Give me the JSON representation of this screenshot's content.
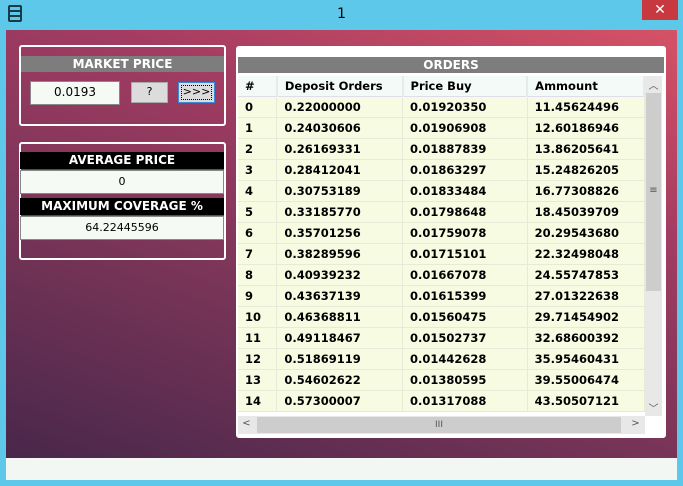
{
  "window": {
    "title": "1",
    "close_label": "✕"
  },
  "market": {
    "title": "MARKET PRICE",
    "value": "0.0193",
    "help_label": "?",
    "go_label": ">>>"
  },
  "stats": {
    "avg_title": "AVERAGE PRICE",
    "avg_value": "0",
    "cov_title": "MAXIMUM COVERAGE %",
    "cov_value": "64.22445596"
  },
  "orders": {
    "title": "ORDERS",
    "columns": [
      "#",
      "Deposit Orders",
      "Price Buy",
      "Ammount"
    ],
    "rows": [
      [
        "0",
        "0.22000000",
        "0.01920350",
        "11.45624496"
      ],
      [
        "1",
        "0.24030606",
        "0.01906908",
        "12.60186946"
      ],
      [
        "2",
        "0.26169331",
        "0.01887839",
        "13.86205641"
      ],
      [
        "3",
        "0.28412041",
        "0.01863297",
        "15.24826205"
      ],
      [
        "4",
        "0.30753189",
        "0.01833484",
        "16.77308826"
      ],
      [
        "5",
        "0.33185770",
        "0.01798648",
        "18.45039709"
      ],
      [
        "6",
        "0.35701256",
        "0.01759078",
        "20.29543680"
      ],
      [
        "7",
        "0.38289596",
        "0.01715101",
        "22.32498048"
      ],
      [
        "8",
        "0.40939232",
        "0.01667078",
        "24.55747853"
      ],
      [
        "9",
        "0.43637139",
        "0.01615399",
        "27.01322638"
      ],
      [
        "10",
        "0.46368811",
        "0.01560475",
        "29.71454902"
      ],
      [
        "11",
        "0.49118467",
        "0.01502737",
        "32.68600392"
      ],
      [
        "12",
        "0.51869119",
        "0.01442628",
        "35.95460431"
      ],
      [
        "13",
        "0.54602622",
        "0.01380595",
        "39.55006474"
      ],
      [
        "14",
        "0.57300007",
        "0.01317088",
        "43.50507121"
      ]
    ]
  }
}
